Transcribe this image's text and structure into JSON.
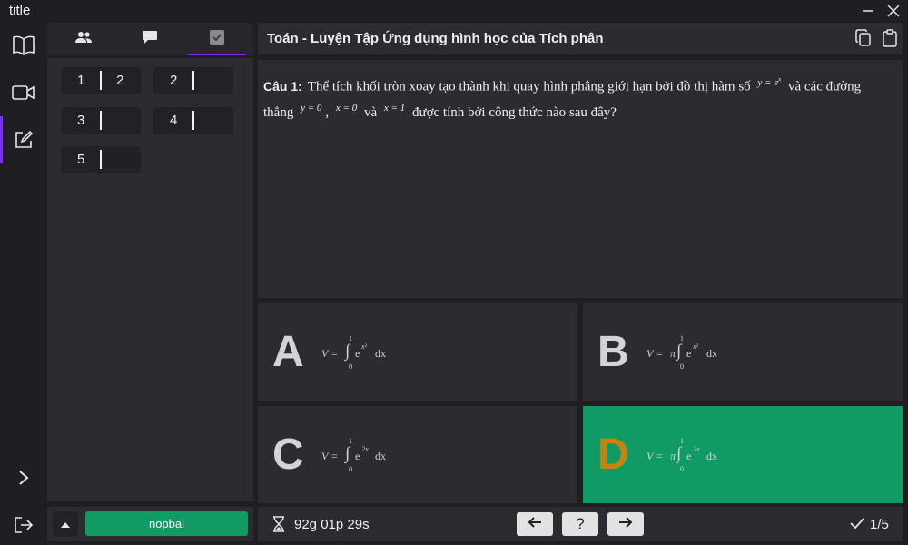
{
  "app": {
    "title": "title"
  },
  "window": {
    "minimize_icon": "minimize-icon",
    "close_icon": "close-icon"
  },
  "rail": {
    "items": [
      {
        "name": "book-icon"
      },
      {
        "name": "video-icon"
      },
      {
        "name": "edit-icon",
        "active": true
      },
      {
        "name": "chevron-right-icon"
      },
      {
        "name": "logout-icon"
      }
    ]
  },
  "left_panel": {
    "tabs": [
      {
        "icon": "people-icon"
      },
      {
        "icon": "chat-icon"
      },
      {
        "icon": "checkbox-icon",
        "active": true
      }
    ],
    "answers": [
      {
        "num": "1",
        "value": "2"
      },
      {
        "num": "2",
        "value": ""
      },
      {
        "num": "3",
        "value": ""
      },
      {
        "num": "4",
        "value": ""
      },
      {
        "num": "5",
        "value": ""
      }
    ],
    "submit_label": "nopbai"
  },
  "header": {
    "title": "Toán - Luyện Tập Ứng dụng hình học của Tích phân"
  },
  "question": {
    "label": "Câu 1:",
    "text_1": "Thể tích khối tròn xoay tạo thành khi quay hình phẳng giới hạn bởi đồ thị hàm số",
    "math_1": "y = e",
    "math_1_sup": "x",
    "text_2": "và các đường thẳng",
    "math_2": "y = 0",
    "text_3": ",",
    "math_3": "x = 0",
    "text_4": "và",
    "math_4": "x = 1",
    "text_5": "được tính bởi công thức nào sau đây?"
  },
  "options": [
    {
      "letter": "A",
      "lhs": "V =",
      "pi": "",
      "upper": "1",
      "lower": "0",
      "base": "e",
      "exp": "x²",
      "dx": "dx"
    },
    {
      "letter": "B",
      "lhs": "V =",
      "pi": "π",
      "upper": "1",
      "lower": "0",
      "base": "e",
      "exp": "x²",
      "dx": "dx"
    },
    {
      "letter": "C",
      "lhs": "V =",
      "pi": "",
      "upper": "1",
      "lower": "0",
      "base": "e",
      "exp": "2x",
      "dx": "dx"
    },
    {
      "letter": "D",
      "lhs": "V =",
      "pi": "π",
      "upper": "1",
      "lower": "0",
      "base": "e",
      "exp": "2x",
      "dx": "dx",
      "selected": true
    }
  ],
  "footer": {
    "timer": "92g 01p 29s",
    "prev": "←",
    "help": "?",
    "next": "→",
    "progress": "1/5"
  },
  "colors": {
    "accent": "#7b2ff7",
    "success": "#0f9b63",
    "letter_selected": "#c5830f"
  }
}
